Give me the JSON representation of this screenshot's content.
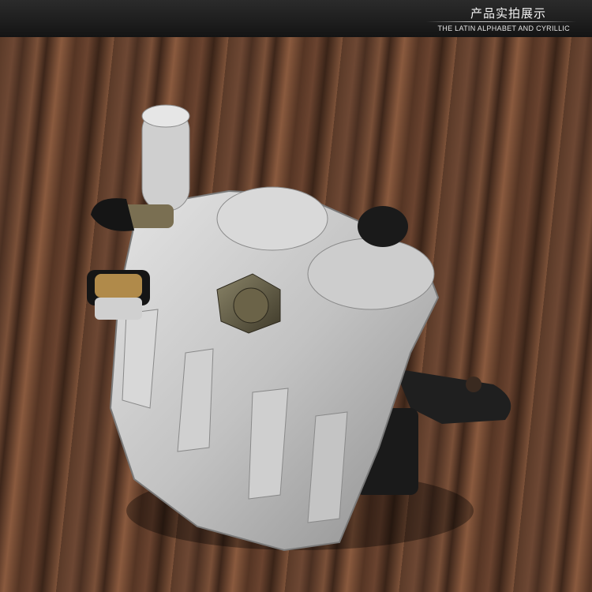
{
  "header": {
    "title_cn": "产品实拍展示",
    "title_en": "THE LATIN ALPHABET AND CYRILLIC"
  },
  "photo": {
    "subject": "brake-caliper-icon"
  },
  "colors": {
    "header_bg": "#1c1c1c",
    "caliper": "#c9c9c9",
    "wood_dark": "#3d261a",
    "wood_light": "#8a5a3e"
  }
}
